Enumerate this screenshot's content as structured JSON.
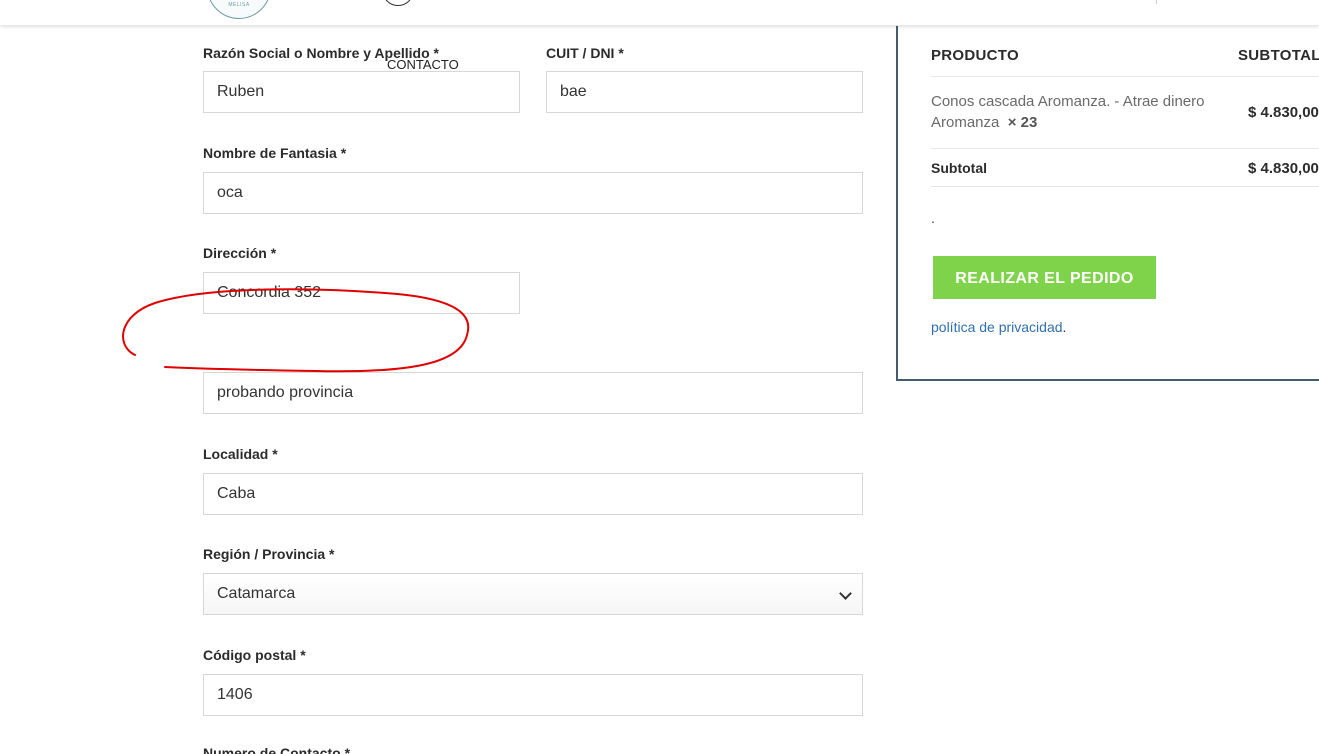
{
  "header": {
    "logo_text": "MELISA",
    "nav_contact": "CONTACTO"
  },
  "form": {
    "razon_social": {
      "label": "Razón Social o Nombre y Apellido *",
      "value": "Ruben"
    },
    "cuit": {
      "label": "CUIT / DNI  *",
      "value": "bae"
    },
    "fantasia": {
      "label": "Nombre de Fantasia  *",
      "value": "oca"
    },
    "direccion": {
      "label": "Dirección  *",
      "value": "Concordia 352"
    },
    "provincia_text": {
      "value": "probando provincia"
    },
    "localidad": {
      "label": "Localidad *",
      "value": "Caba"
    },
    "region": {
      "label": "Región / Provincia *",
      "value": "Catamarca"
    },
    "codigo_postal": {
      "label": "Código postal *",
      "value": "1406"
    },
    "numero_contacto": {
      "label": "Numero de Contacto *"
    }
  },
  "order": {
    "col_product": "PRODUCTO",
    "col_subtotal": "SUBTOTAL",
    "item_name": "Conos cascada Aromanza. - Atrae dinero Aromanza",
    "item_qty": "× 23",
    "item_price": "$ 4.830,00",
    "subtotal_label": "Subtotal",
    "subtotal_value": "$ 4.830,00",
    "dot": ".",
    "place_order": "REALIZAR EL PEDIDO",
    "privacy_link": "política de privacidad",
    "privacy_suffix": "."
  },
  "colors": {
    "accent_green": "#7ed34a",
    "link_blue": "#2f6fb1",
    "summary_border": "#445b70",
    "annotation_red": "#e00000"
  }
}
